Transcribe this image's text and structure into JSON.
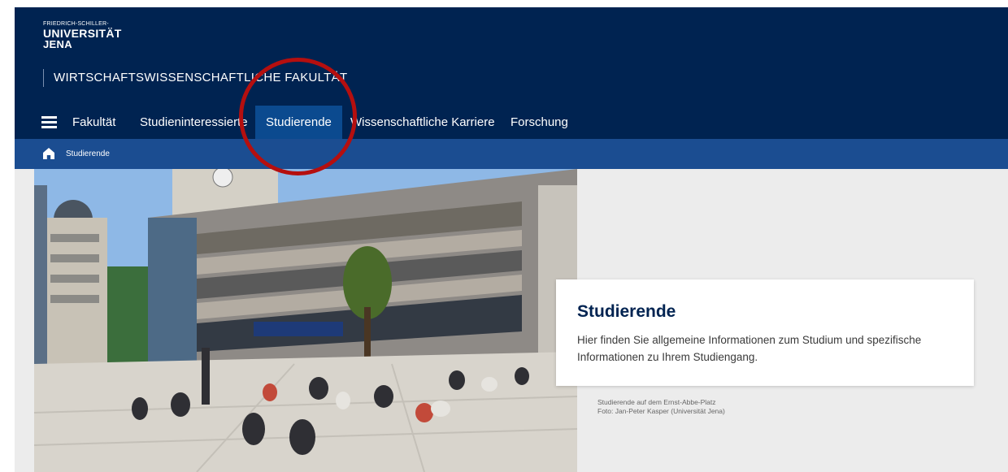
{
  "header": {
    "logo": {
      "line1": "FRIEDRICH-SCHILLER-",
      "line2": "UNIVERSITÄT",
      "line3": "JENA"
    },
    "faculty": "WIRTSCHAFTSWISSENSCHAFTLICHE FAKULTÄT",
    "menu_icon": "hamburger-icon",
    "nav": {
      "items": [
        {
          "label": "Fakultät"
        },
        {
          "label": "Studieninteressierte"
        },
        {
          "label": "Studierende",
          "active": true
        },
        {
          "label": "Wissenschaftliche Karriere"
        },
        {
          "label": "Forschung"
        }
      ]
    }
  },
  "breadcrumb": {
    "home_icon": "home-icon",
    "current": "Studierende"
  },
  "hero": {
    "card": {
      "title": "Studierende",
      "text": "Hier finden Sie allgemeine Informationen zum Studium und spezifische Informationen zu Ihrem Studiengang."
    },
    "caption_line1": "Studierende auf dem Ernst-Abbe-Platz",
    "caption_line2": "Foto: Jan-Peter Kasper (Universität Jena)"
  },
  "colors": {
    "header_bg": "#002351",
    "breadcrumb_bg": "#1b4d91",
    "active_tab_bg": "#0b4a8f",
    "annotation": "#b50f0f"
  }
}
